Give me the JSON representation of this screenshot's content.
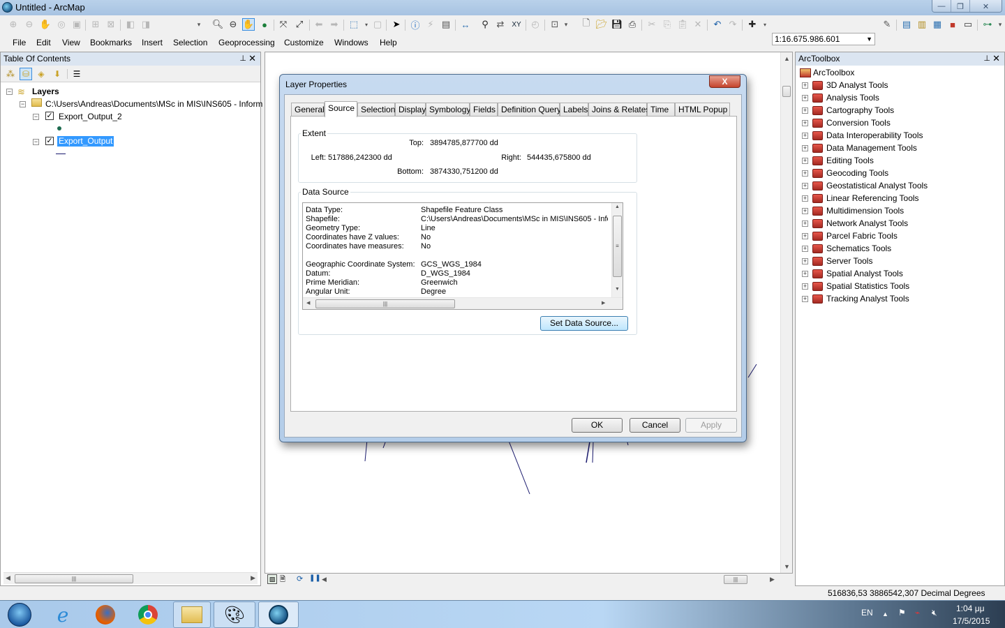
{
  "window": {
    "title": "Untitled - ArcMap",
    "controls": {
      "minimize": "—",
      "restore": "❐",
      "close": "✕"
    }
  },
  "toolbar": {
    "scale_value": "1:16.675.986.601",
    "icons": [
      "fixed-zoom-in-icon",
      "fixed-zoom-out-icon",
      "pan-icon",
      "full-extent-icon",
      "zoom-100-icon",
      "zoom-in-icon",
      "zoom-out-icon",
      "pan-hand-icon",
      "globe-full-extent-icon",
      "fixed-zoom-in-arrows-icon",
      "fixed-zoom-out-arrows-icon",
      "back-icon",
      "forward-icon",
      "select-features-icon",
      "clear-selection-icon",
      "select-elements-icon",
      "identify-icon",
      "hyperlink-icon",
      "html-popup-icon",
      "measure-icon",
      "find-icon",
      "find-route-icon",
      "go-to-xy-icon",
      "time-slider-icon",
      "magnifier-icon",
      "new-icon",
      "open-icon",
      "save-icon",
      "print-icon",
      "cut-icon",
      "copy-icon",
      "paste-icon",
      "delete-icon",
      "undo-icon",
      "redo-icon",
      "add-data-icon",
      "editor-icon",
      "toc-window-icon",
      "catalog-window-icon",
      "search-window-icon",
      "arctoolbox-icon",
      "python-icon",
      "model-builder-icon"
    ]
  },
  "menu": [
    "File",
    "Edit",
    "View",
    "Bookmarks",
    "Insert",
    "Selection",
    "Geoprocessing",
    "Customize",
    "Windows",
    "Help"
  ],
  "toc": {
    "title": "Table Of Contents",
    "pin": "ꟻ",
    "close": "✕",
    "root": "Layers",
    "folder": "C:\\Users\\Andreas\\Documents\\MSc in MIS\\INS605 - Inform",
    "layers": [
      {
        "name": "Export_Output_2",
        "checked": true,
        "selected": false,
        "symbol": "point"
      },
      {
        "name": "Export_Output",
        "checked": true,
        "selected": true,
        "symbol": "line"
      }
    ]
  },
  "toolbox": {
    "title": "ArcToolbox",
    "root": "ArcToolbox",
    "items": [
      "3D Analyst Tools",
      "Analysis Tools",
      "Cartography Tools",
      "Conversion Tools",
      "Data Interoperability Tools",
      "Data Management Tools",
      "Editing Tools",
      "Geocoding Tools",
      "Geostatistical Analyst Tools",
      "Linear Referencing Tools",
      "Multidimension Tools",
      "Network Analyst Tools",
      "Parcel Fabric Tools",
      "Schematics Tools",
      "Server Tools",
      "Spatial Analyst Tools",
      "Spatial Statistics Tools",
      "Tracking Analyst Tools"
    ]
  },
  "dialog": {
    "title": "Layer Properties",
    "close": "X",
    "tabs": [
      "General",
      "Source",
      "Selection",
      "Display",
      "Symbology",
      "Fields",
      "Definition Query",
      "Labels",
      "Joins & Relates",
      "Time",
      "HTML Popup"
    ],
    "active_tab": "Source",
    "extent": {
      "label": "Extent",
      "top_label": "Top:",
      "top": "3894785,877700 dd",
      "left_label": "Left:",
      "left": "517886,242300 dd",
      "right_label": "Right:",
      "right": "544435,675800 dd",
      "bottom_label": "Bottom:",
      "bottom": "3874330,751200 dd"
    },
    "data_source": {
      "label": "Data Source",
      "rows": [
        {
          "key": "Data Type:",
          "value": "Shapefile Feature Class"
        },
        {
          "key": "Shapefile:",
          "value": "C:\\Users\\Andreas\\Documents\\MSc in MIS\\INS605 - Info"
        },
        {
          "key": "Geometry Type:",
          "value": "Line"
        },
        {
          "key": "Coordinates have Z values:",
          "value": "No"
        },
        {
          "key": "Coordinates have measures:",
          "value": "No"
        },
        {
          "key": "",
          "value": ""
        },
        {
          "key": "Geographic Coordinate System:",
          "value": "GCS_WGS_1984"
        },
        {
          "key": "Datum:",
          "value": "D_WGS_1984"
        },
        {
          "key": "Prime Meridian:",
          "value": "Greenwich"
        },
        {
          "key": "Angular Unit:",
          "value": "Degree"
        }
      ]
    },
    "set_data_source": "Set Data Source...",
    "ok": "OK",
    "cancel": "Cancel",
    "apply": "Apply"
  },
  "status": {
    "coords": "516836,53  3886542,307 Decimal Degrees"
  },
  "taskbar": {
    "apps": [
      "start-button",
      "internet-explorer",
      "firefox",
      "chrome",
      "windows-explorer",
      "paint",
      "arcmap"
    ],
    "lang": "EN",
    "time": "1:04 μμ",
    "date": "17/5/2015"
  },
  "colors": {
    "selection": "#3399ff",
    "map_line": "#1a1a6e",
    "toolbox_icon": "#c0392b"
  }
}
